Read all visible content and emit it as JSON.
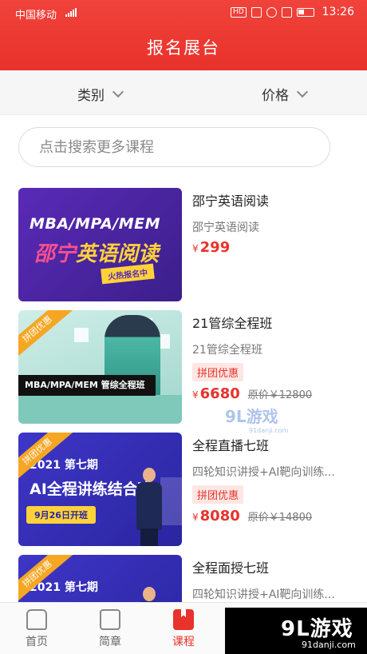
{
  "status_bar": {
    "carrier": "中国移动",
    "network": "4G",
    "time": "13:26",
    "hd": "HD"
  },
  "header": {
    "title": "报名展台"
  },
  "filters": [
    {
      "label": "类别"
    },
    {
      "label": "价格"
    }
  ],
  "search": {
    "placeholder": "点击搜索更多课程"
  },
  "courses": [
    {
      "title": "邵宁英语阅读",
      "subtitle": "邵宁英语阅读",
      "price": "299",
      "currency": "¥",
      "thumb": {
        "line1": "MBA/MPA/MEM",
        "line2a": "邵宁",
        "line2b": "英语阅读",
        "badge": "火热报名中"
      }
    },
    {
      "title": "21管综全程班",
      "subtitle": "21管综全程班",
      "tag": "拼团优惠",
      "price": "6680",
      "currency": "¥",
      "original_price": "原价￥12800",
      "thumb": {
        "ribbon": "拼团优惠",
        "caption": "MBA/MPA/MEM 管综全程班"
      }
    },
    {
      "title": "全程直播七班",
      "subtitle": "四轮知识讲授+AI靶向训练...",
      "tag": "拼团优惠",
      "price": "8080",
      "currency": "¥",
      "original_price": "原价￥14800",
      "thumb": {
        "ribbon": "拼团优惠",
        "year": "2021 第七期",
        "headline": "AI全程讲练结合班",
        "date": "9月26日开班"
      }
    },
    {
      "title": "全程面授七班",
      "subtitle": "四轮知识讲授+AI靶向训练...",
      "thumb": {
        "ribbon": "拼团优惠",
        "year": "2021 第七期"
      }
    }
  ],
  "tabs": [
    {
      "label": "首页",
      "icon": "home-icon"
    },
    {
      "label": "简章",
      "icon": "profile-card-icon"
    },
    {
      "label": "课程",
      "icon": "bookmark-icon",
      "active": true
    }
  ],
  "watermarks": {
    "mid_logo": "9L游戏",
    "mid_url": "91danji.com",
    "corner_logo": "9L游戏",
    "corner_url": "91danji.com"
  },
  "colors": {
    "accent": "#e8322b",
    "tag_bg": "#fde6e3",
    "ribbon": "#f5a623"
  }
}
